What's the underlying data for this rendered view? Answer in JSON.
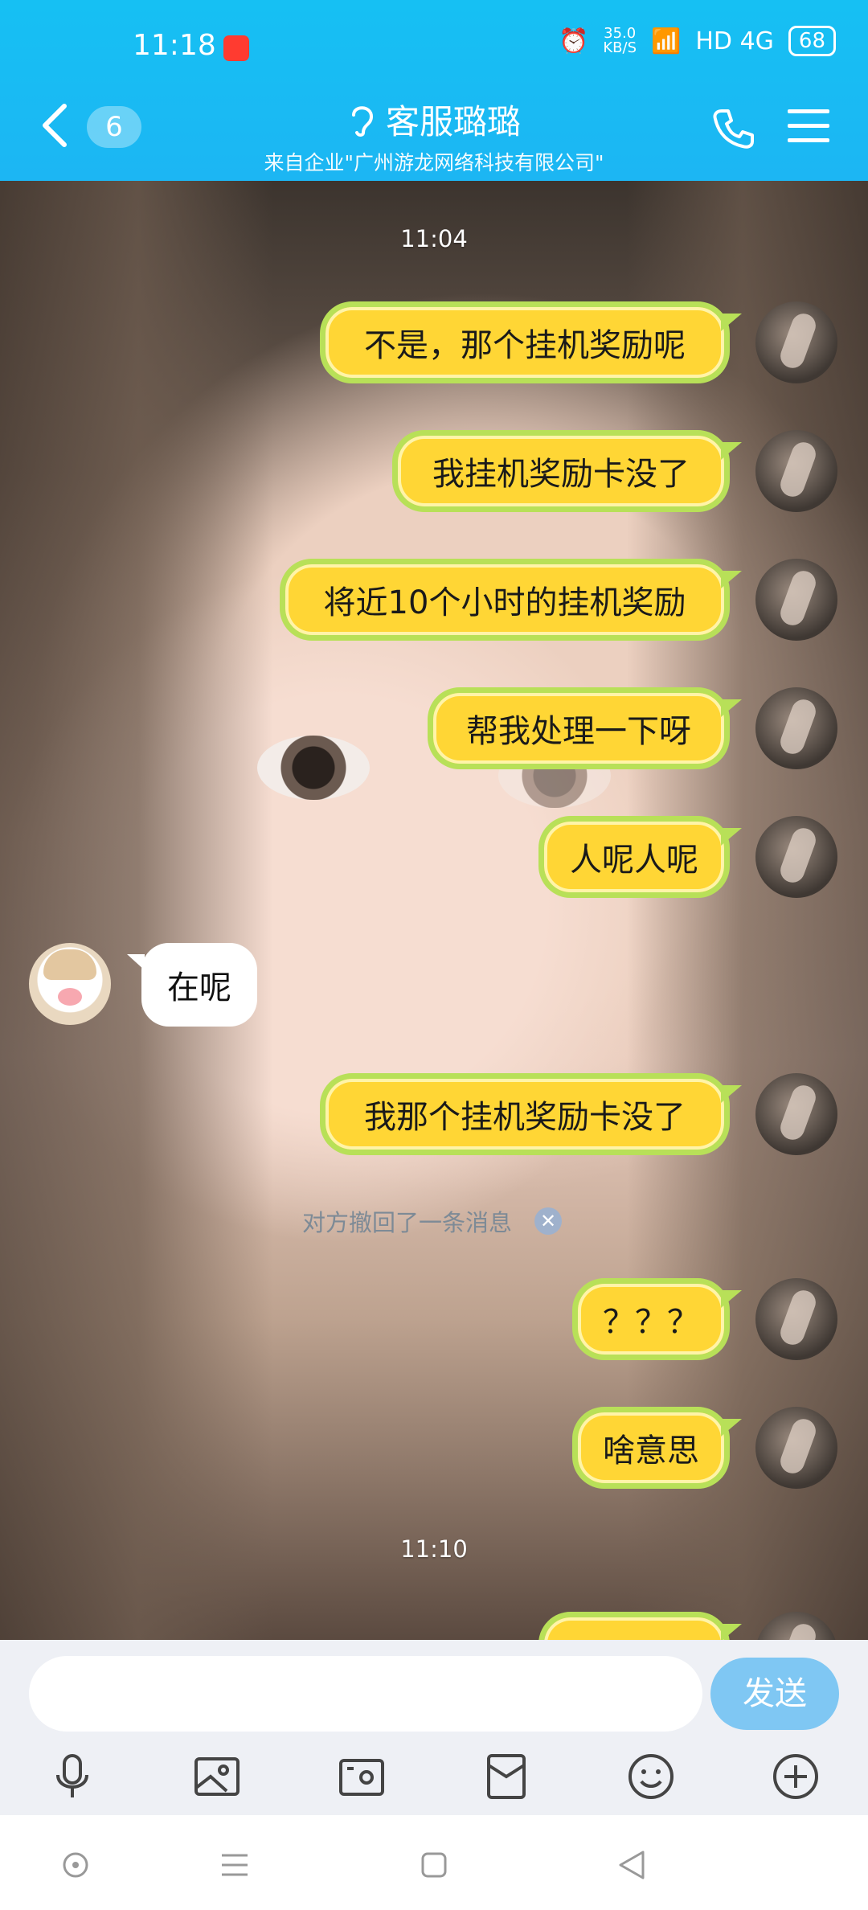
{
  "status": {
    "time": "11:18",
    "speed": "35.0\nKB/S",
    "network": "HD 4G",
    "battery": "68"
  },
  "header": {
    "unread": "6",
    "title": "客服璐璐",
    "subtitle": "来自企业\"广州游龙网络科技有限公司\""
  },
  "chat": {
    "timestamps": [
      "11:04",
      "11:10"
    ],
    "messages_me": [
      "不是，那个挂机奖励呢",
      "我挂机奖励卡没了",
      "将近10个小时的挂机奖励",
      "帮我处理一下呀",
      "人呢人呢",
      "我那个挂机奖励卡没了",
      "？？？",
      "啥意思"
    ],
    "messages_cs": [
      "在呢"
    ],
    "recall_notice": "对方撤回了一条消息"
  },
  "input": {
    "placeholder": "",
    "send": "发送"
  },
  "colors": {
    "header": "#1cb6f3",
    "bubble_fill": "#ffd635",
    "bubble_border": "#b8e058",
    "send": "#7fc7f3"
  }
}
